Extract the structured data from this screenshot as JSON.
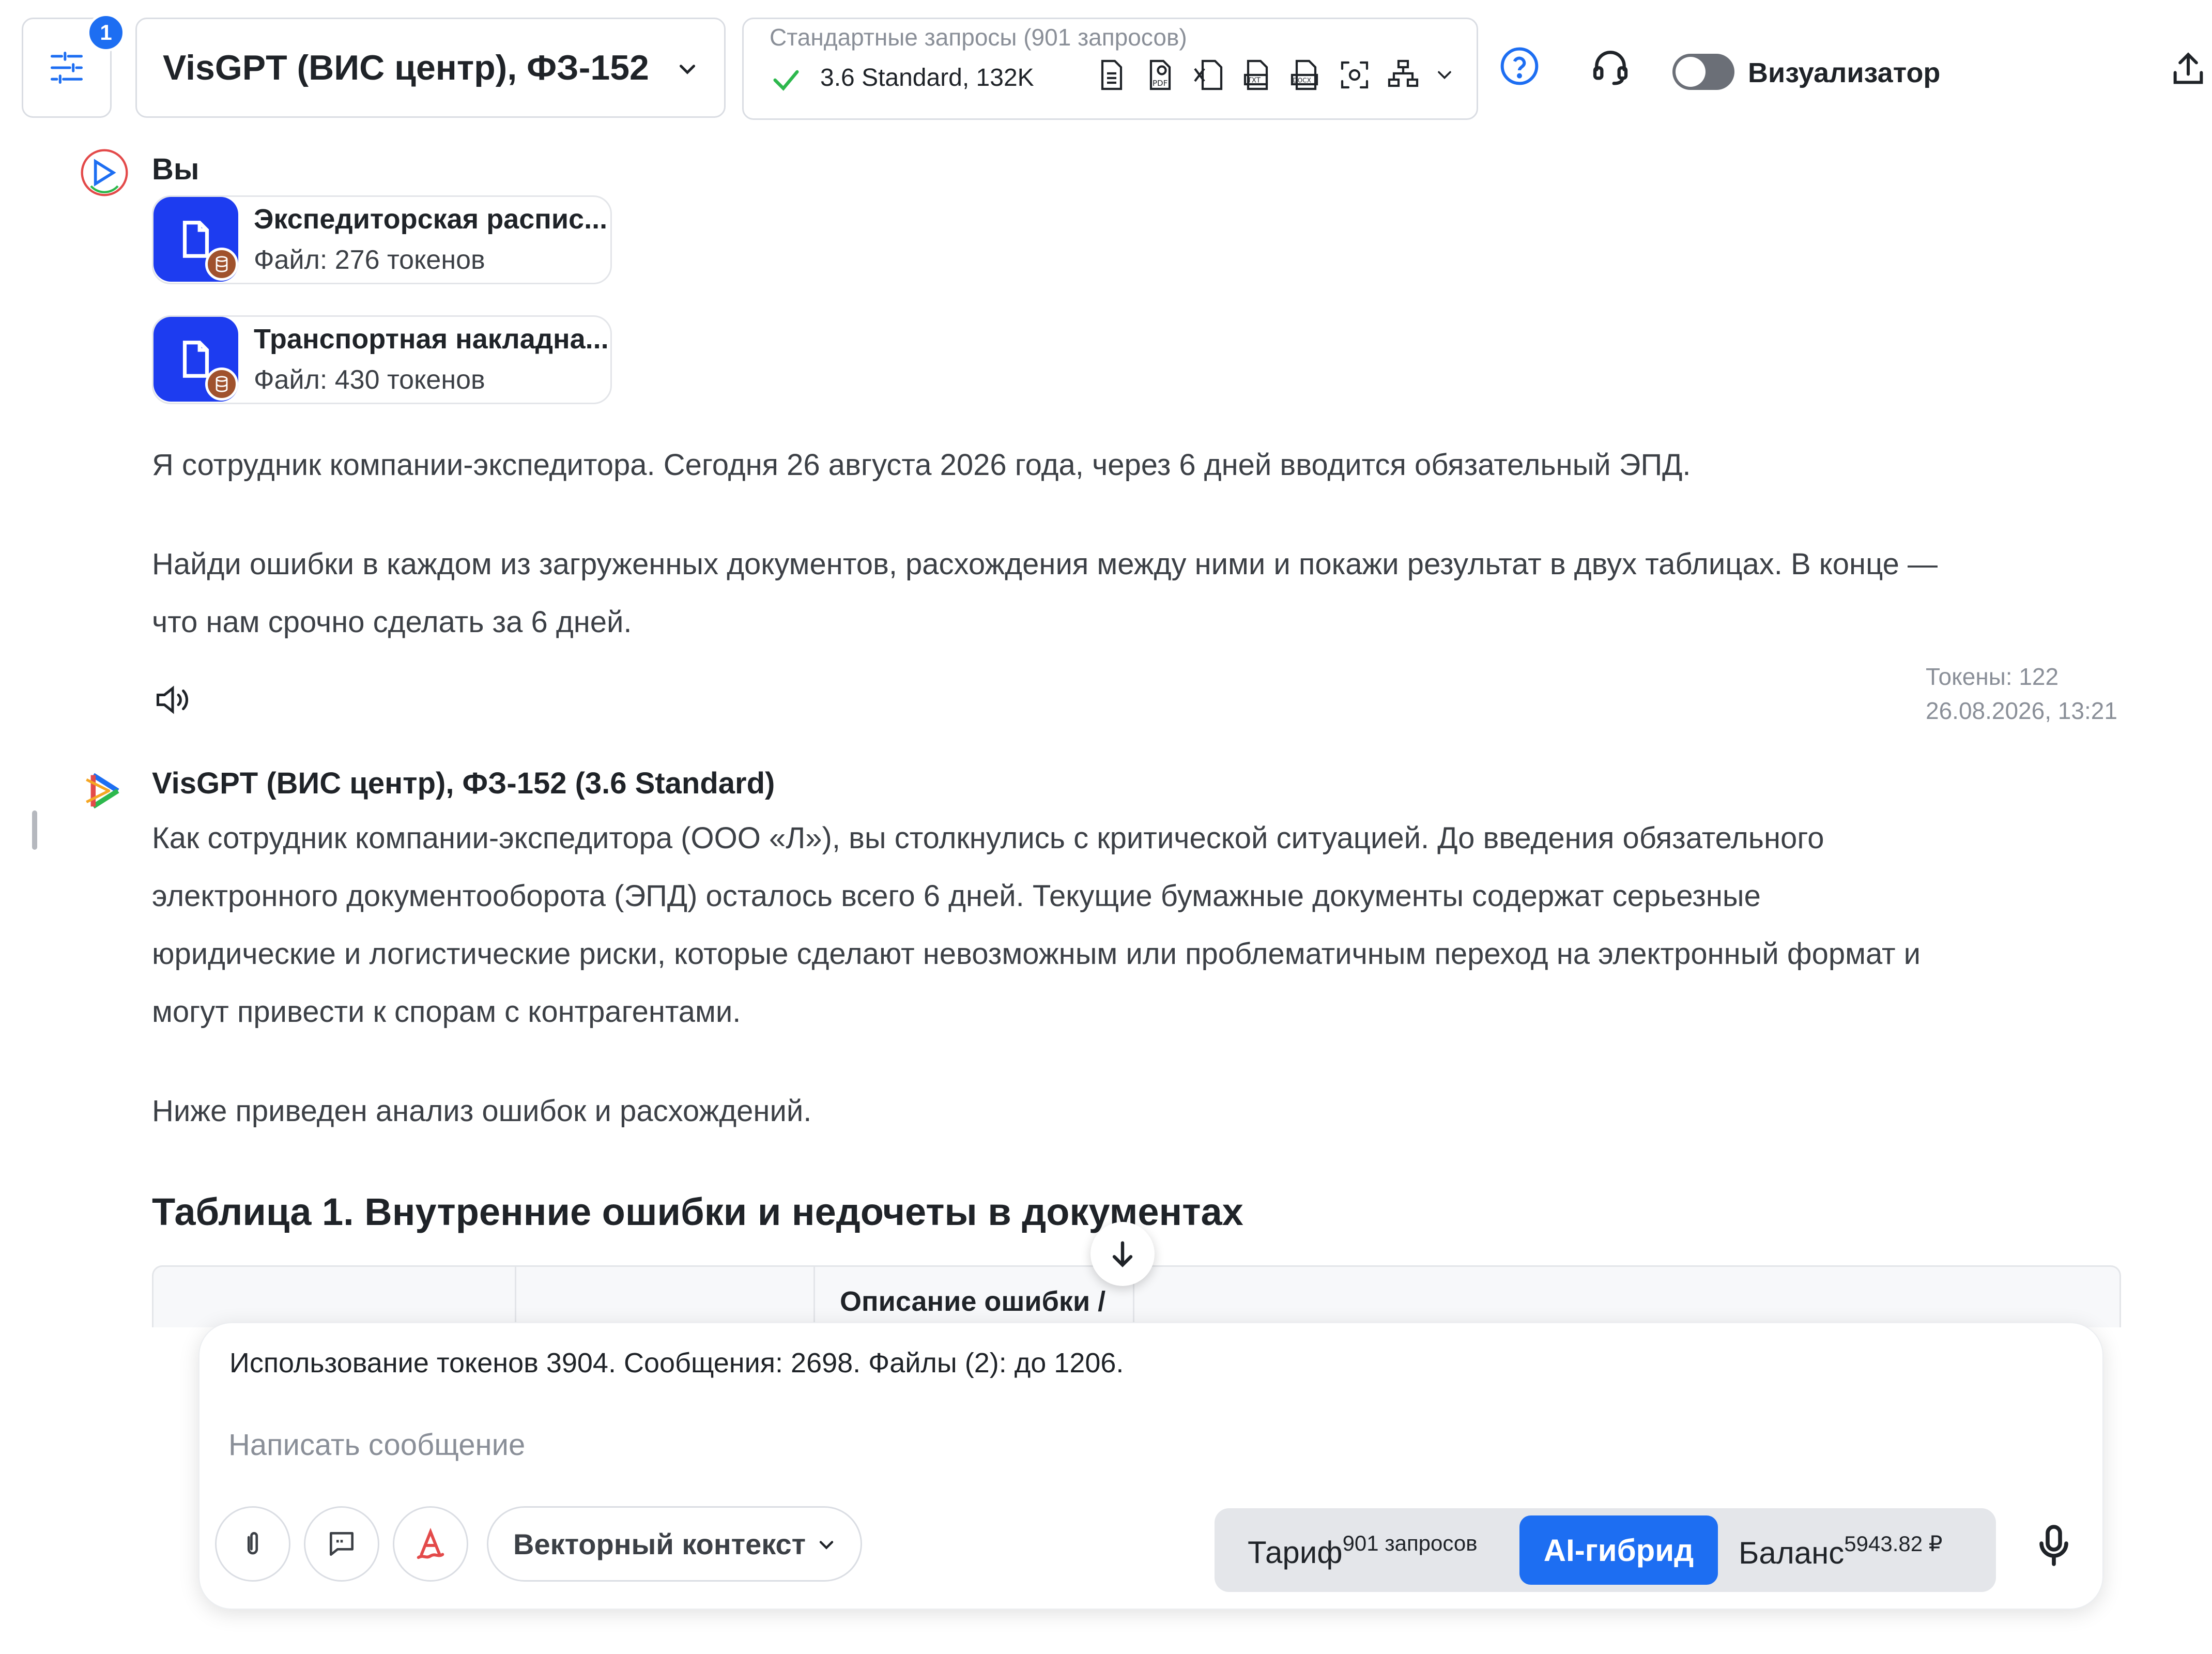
{
  "header": {
    "settings_badge": "1",
    "model_title": "VisGPT (ВИС центр), ФЗ-152",
    "requests_caption": "Стандартные запросы (901 запросов)",
    "requests_version": "3.6 Standard, 132K",
    "visualizer_label": "Визуализатор",
    "visualizer_on": false,
    "format_icons": [
      "doc-icon",
      "pdf-icon",
      "xls-icon",
      "txt-icon",
      "docx-icon",
      "scan-icon",
      "hierarchy-icon"
    ]
  },
  "user_message": {
    "author": "Вы",
    "files": [
      {
        "name": "Экспедиторская распис...",
        "size": "Файл: 276 токенов"
      },
      {
        "name": "Транспортная накладна...",
        "size": "Файл: 430 токенов"
      }
    ],
    "paragraphs": [
      "Я сотрудник компании-экспедитора. Сегодня 26 августа 2026 года, через 6 дней вводится обязательный ЭПД.",
      "Найди ошибки в каждом из загруженных документов, расхождения между ними и покажи результат в двух таблицах. В конце —",
      "что нам срочно сделать за 6 дней."
    ],
    "tokens": "Токены: 122",
    "timestamp": "26.08.2026, 13:21"
  },
  "bot_message": {
    "author": "VisGPT (ВИС центр), ФЗ-152 (3.6 Standard)",
    "lines": [
      "Как сотрудник компании-экспедитора (ООО «Л»), вы столкнулись с критической ситуацией. До введения обязательного",
      "электронного документооборота (ЭПД) осталось всего 6 дней. Текущие бумажные документы содержат серьезные",
      "юридические и логистические риски, которые сделают невозможным или проблематичным переход на электронный формат и",
      "могут привести к спорам с контрагентами."
    ],
    "summary": "Ниже приведен анализ ошибок и расхождений.",
    "table_heading": "Таблица 1. Внутренние ошибки и недочеты в документах",
    "table_header_cell": "Описание ошибки /"
  },
  "composer": {
    "usage": "Использование токенов 3904. Сообщения: 2698. Файлы (2): до 1206.",
    "placeholder": "Написать сообщение",
    "vector_context": "Векторный контекст",
    "tarif_label": "Тариф",
    "tarif_sup": "901 запросов",
    "ai_hybrid": "AI-гибрид",
    "balance_label": "Баланс",
    "balance_sup": "5943.82 ₽"
  },
  "colors": {
    "accent": "#1d6ef2",
    "file_icon_bg": "#1d3cf0",
    "check": "#2db84d"
  }
}
